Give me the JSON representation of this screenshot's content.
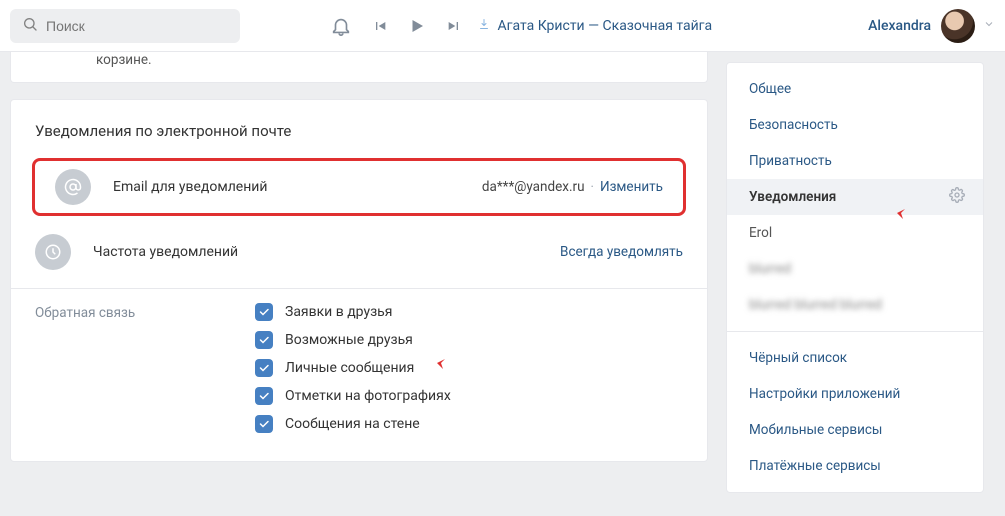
{
  "header": {
    "search_placeholder": "Поиск",
    "track": "Агата Кристи — Сказочная тайга",
    "username": "Alexandra"
  },
  "frag": {
    "line1": "корзине."
  },
  "panel": {
    "title": "Уведомления по электронной почте",
    "email_row": {
      "label": "Email для уведомлений",
      "value": "da***@yandex.ru",
      "change": "Изменить"
    },
    "freq_row": {
      "label": "Частота уведомлений",
      "link": "Всегда уведомлять"
    },
    "feedback": {
      "group_label": "Обратная связь",
      "items": [
        "Заявки в друзья",
        "Возможные друзья",
        "Личные сообщения",
        "Отметки на фотографиях",
        "Сообщения на стене"
      ]
    }
  },
  "sidebar": {
    "items": [
      {
        "label": "Общее"
      },
      {
        "label": "Безопасность"
      },
      {
        "label": "Приватность"
      },
      {
        "label": "Уведомления",
        "active": true
      },
      {
        "label": "Erol",
        "grey": true
      },
      {
        "label": "blurred",
        "blurred": true
      },
      {
        "label": "blurred blurred blurred",
        "blurred": true
      }
    ],
    "items2": [
      "Чёрный список",
      "Настройки приложений",
      "Мобильные сервисы",
      "Платёжные сервисы"
    ]
  }
}
